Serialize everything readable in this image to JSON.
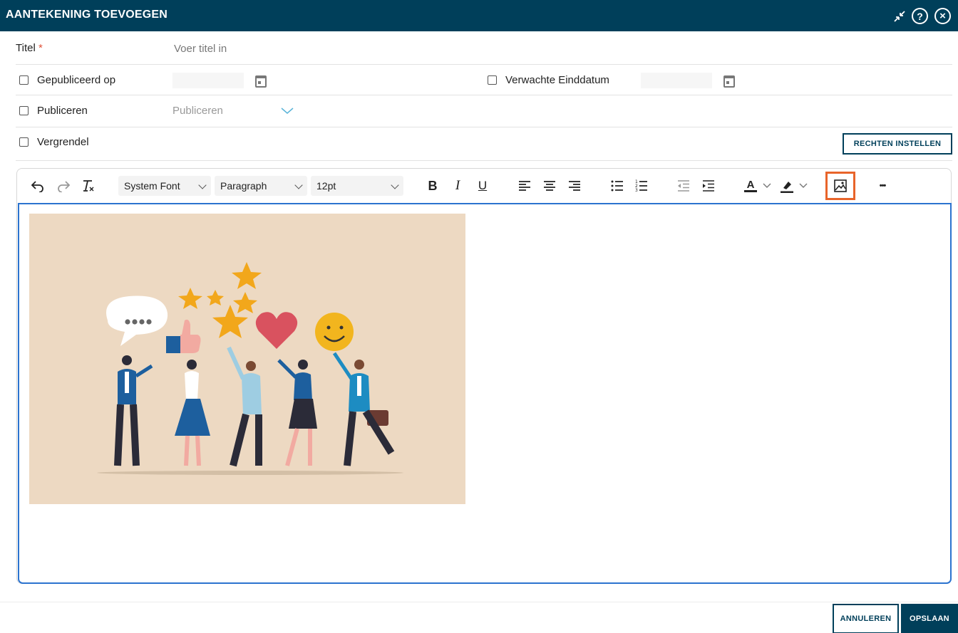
{
  "dialog": {
    "title": "AANTEKENING TOEVOEGEN",
    "help_glyph": "?",
    "close_glyph": "×"
  },
  "form": {
    "title_label": "Titel",
    "required_mark": "*",
    "title_placeholder": "Voer titel in",
    "published_on_label": "Gepubliceerd op",
    "expected_end_label": "Verwachte Einddatum",
    "publish_label": "Publiceren",
    "publish_placeholder": "Publiceren",
    "lock_label": "Vergrendel",
    "rights_button": "RECHTEN INSTELLEN"
  },
  "editor": {
    "font": "System Font",
    "block": "Paragraph",
    "size": "12pt",
    "bold": "B",
    "italic": "I",
    "underline": "U",
    "text_color_glyph": "A",
    "more": "•••",
    "highlight_color": "#e8642a",
    "image_bg": "#edd9c2"
  },
  "footer": {
    "cancel_button": "ANNULEREN",
    "save_button": "OPSLAAN"
  },
  "colors": {
    "primary": "#003f5a",
    "accent_border": "#2b73cf",
    "required": "#e0533a"
  }
}
